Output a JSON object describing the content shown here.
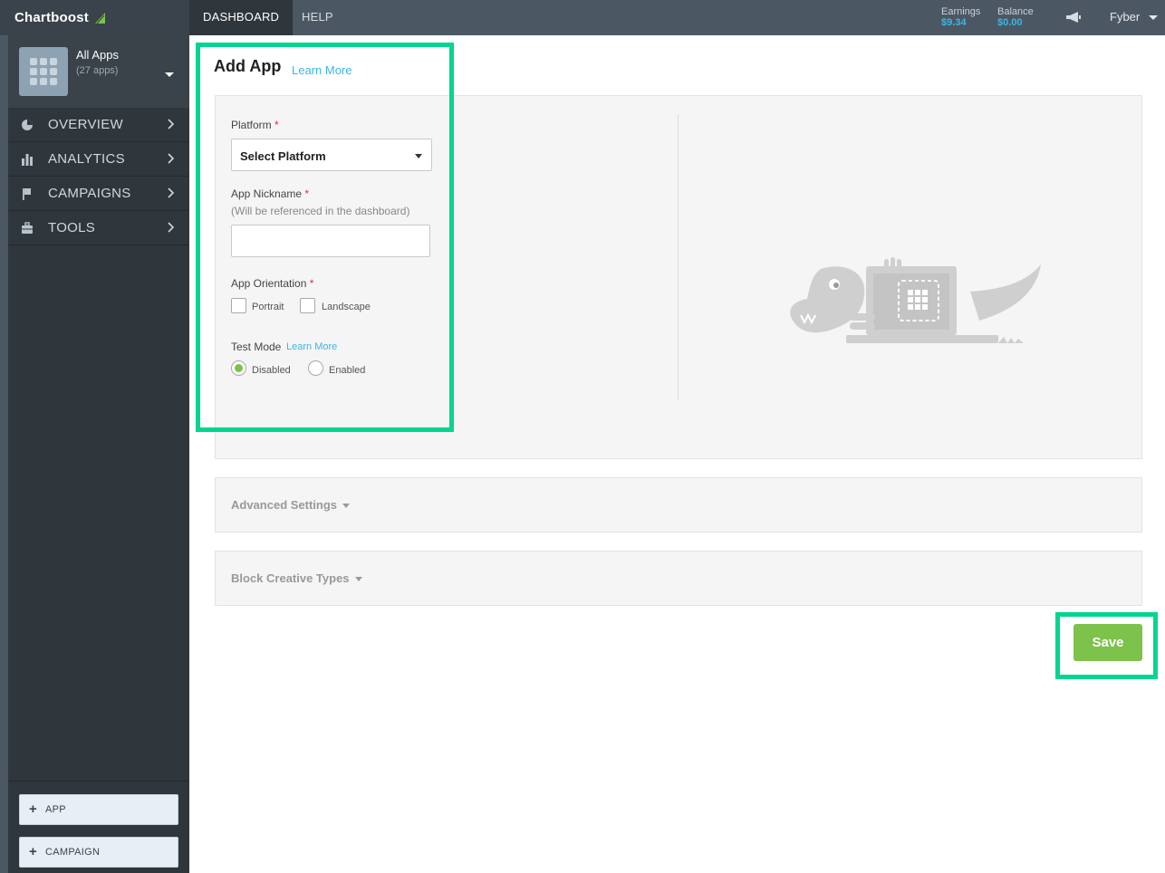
{
  "brand": {
    "name": "Chartboost"
  },
  "topnav": {
    "tabs": [
      {
        "label": "DASHBOARD",
        "active": true
      },
      {
        "label": "HELP",
        "active": false
      }
    ],
    "earnings_label": "Earnings",
    "earnings_value": "$9.34",
    "balance_label": "Balance",
    "balance_value": "$0.00",
    "user": "Fyber"
  },
  "sidebar": {
    "app_selector": {
      "title": "All Apps",
      "count": "(27 apps)"
    },
    "items": [
      {
        "label": "OVERVIEW",
        "icon": "pie-chart-icon"
      },
      {
        "label": "ANALYTICS",
        "icon": "bar-chart-icon"
      },
      {
        "label": "CAMPAIGNS",
        "icon": "flag-icon"
      },
      {
        "label": "TOOLS",
        "icon": "toolbox-icon"
      }
    ],
    "buttons": [
      {
        "label": "APP"
      },
      {
        "label": "CAMPAIGN"
      }
    ]
  },
  "main": {
    "title": "Add App",
    "learn_more": "Learn More",
    "form": {
      "platform_label": "Platform",
      "platform_value": "Select Platform",
      "nickname_label": "App Nickname",
      "nickname_hint": "(Will be referenced in the dashboard)",
      "nickname_value": "",
      "orientation_label": "App Orientation",
      "orientation_options": [
        "Portrait",
        "Landscape"
      ],
      "test_mode_label": "Test Mode",
      "test_mode_learn_more": "Learn More",
      "test_mode_options": [
        "Disabled",
        "Enabled"
      ],
      "test_mode_selected": "Disabled",
      "required_marker": "*"
    },
    "panels": [
      {
        "title": "Advanced Settings"
      },
      {
        "title": "Block Creative Types"
      }
    ],
    "save_label": "Save"
  },
  "colors": {
    "accent_green": "#7dc24b",
    "link_blue": "#3cb6e6",
    "highlight": "#00d68f",
    "topbar": "#4b5863",
    "sidebar": "#2f363c"
  }
}
